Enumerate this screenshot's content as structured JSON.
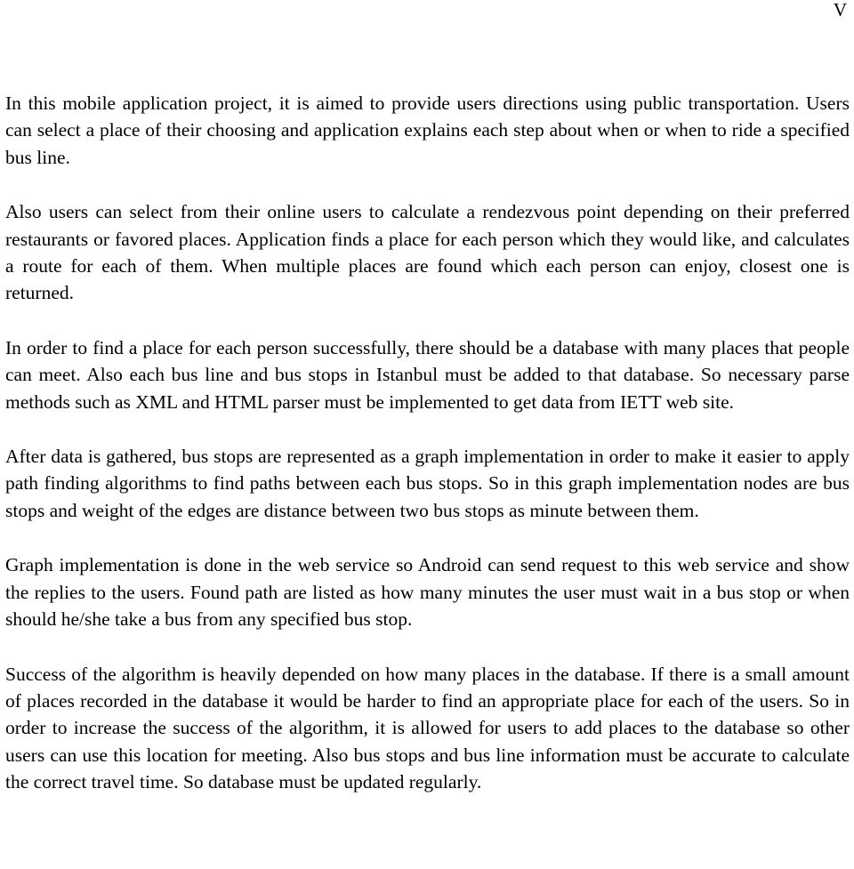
{
  "document": {
    "page_label": "V",
    "paragraphs": [
      "In this mobile application project, it is aimed to provide users directions using public transportation. Users can select a place of their choosing and application explains each step about when or when to ride a specified bus line.",
      "Also users can select from their online users to calculate a rendezvous point depending on their preferred restaurants or favored places. Application finds a place for each person which they would like, and calculates a route for each of them. When multiple places are found which each person can enjoy, closest one is returned.",
      "In order to find a place for each person successfully, there should be a database with many places that people can meet. Also each bus line and bus stops in Istanbul must be added to that database. So necessary parse methods such as XML and HTML parser must be implemented to get data from IETT web site.",
      "After data is gathered, bus stops are represented as a graph implementation in order to make it easier to apply path finding algorithms to find paths between each bus stops. So in this graph implementation nodes are bus stops and weight of the edges are distance between two bus stops as minute between them.",
      "Graph implementation is done in the web service so Android can send request to this web service and show the replies to the users. Found path are listed as how many minutes the user must wait in a bus stop or when should he/she take a bus from any specified bus stop.",
      "Success of the algorithm is heavily depended on how many places in the database. If there is a small amount of places recorded in the database it would be harder to find an appropriate place for each of the users. So in order to increase the success of the algorithm, it is allowed for users to add places to the database so other users can use this location for meeting. Also bus stops and bus line information must be accurate to calculate the correct travel time. So database must be updated regularly."
    ]
  },
  "colors": {
    "page_background": "#ffffff",
    "text": "#000000"
  }
}
